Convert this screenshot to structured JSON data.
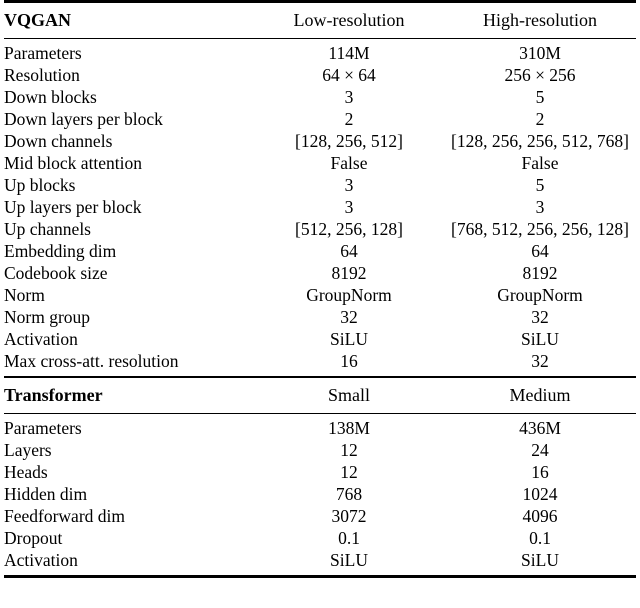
{
  "table": {
    "sections": [
      {
        "title": "VQGAN",
        "columns": [
          "Low-resolution",
          "High-resolution"
        ],
        "rows": [
          {
            "label": "Parameters",
            "values": [
              "114M",
              "310M"
            ]
          },
          {
            "label": "Resolution",
            "values": [
              "64 × 64",
              "256 × 256"
            ]
          },
          {
            "label": "Down blocks",
            "values": [
              "3",
              "5"
            ]
          },
          {
            "label": "Down layers per block",
            "values": [
              "2",
              "2"
            ]
          },
          {
            "label": "Down channels",
            "values": [
              "[128, 256, 512]",
              "[128, 256, 256, 512, 768]"
            ]
          },
          {
            "label": "Mid block attention",
            "values": [
              "False",
              "False"
            ]
          },
          {
            "label": "Up blocks",
            "values": [
              "3",
              "5"
            ]
          },
          {
            "label": "Up layers per block",
            "values": [
              "3",
              "3"
            ]
          },
          {
            "label": "Up channels",
            "values": [
              "[512, 256, 128]",
              "[768, 512, 256, 256, 128]"
            ]
          },
          {
            "label": "Embedding dim",
            "values": [
              "64",
              "64"
            ]
          },
          {
            "label": "Codebook size",
            "values": [
              "8192",
              "8192"
            ]
          },
          {
            "label": "Norm",
            "values": [
              "GroupNorm",
              "GroupNorm"
            ]
          },
          {
            "label": "Norm group",
            "values": [
              "32",
              "32"
            ]
          },
          {
            "label": "Activation",
            "values": [
              "SiLU",
              "SiLU"
            ]
          },
          {
            "label": "Max cross-att. resolution",
            "values": [
              "16",
              "32"
            ]
          }
        ]
      },
      {
        "title": "Transformer",
        "columns": [
          "Small",
          "Medium"
        ],
        "rows": [
          {
            "label": "Parameters",
            "values": [
              "138M",
              "436M"
            ]
          },
          {
            "label": "Layers",
            "values": [
              "12",
              "24"
            ]
          },
          {
            "label": "Heads",
            "values": [
              "12",
              "16"
            ]
          },
          {
            "label": "Hidden dim",
            "values": [
              "768",
              "1024"
            ]
          },
          {
            "label": "Feedforward dim",
            "values": [
              "3072",
              "4096"
            ]
          },
          {
            "label": "Dropout",
            "values": [
              "0.1",
              "0.1"
            ]
          },
          {
            "label": "Activation",
            "values": [
              "SiLU",
              "SiLU"
            ]
          }
        ]
      }
    ]
  }
}
